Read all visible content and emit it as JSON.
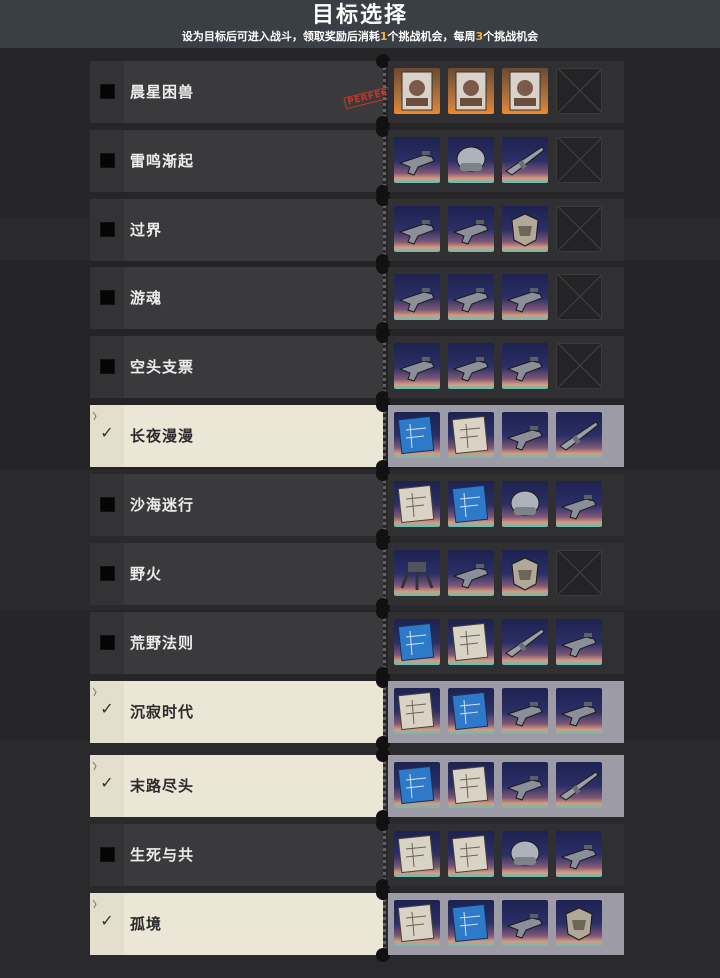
{
  "header": {
    "title": "目标选择",
    "subtitle_pre": "设为目标后可进入战斗，领取奖励后消耗",
    "subtitle_n1": "1",
    "subtitle_mid": "个挑战机会，每周",
    "subtitle_n2": "3",
    "subtitle_post": "个挑战机会"
  },
  "colors": {
    "accent": "#f0b43c",
    "selected_bg": "#ece6d7",
    "stamp": "#c0392b"
  },
  "rows": [
    {
      "label": "晨星困兽",
      "selected": false,
      "stamp": "PERFECT",
      "items": [
        "portrait-icon",
        "portrait-icon",
        "portrait-icon",
        "empty-slot"
      ]
    },
    {
      "label": "雷鸣渐起",
      "selected": false,
      "items": [
        "gun-icon",
        "helmet-icon",
        "rifle-icon",
        "empty-slot"
      ]
    },
    {
      "label": "过界",
      "selected": false,
      "items": [
        "gun-icon",
        "gun-icon",
        "armor-icon",
        "empty-slot"
      ]
    },
    {
      "label": "游魂",
      "selected": false,
      "items": [
        "gun-icon",
        "gun-icon",
        "gun-icon",
        "empty-slot"
      ]
    },
    {
      "label": "空头支票",
      "selected": false,
      "items": [
        "gun-icon",
        "gun-icon",
        "gun-icon",
        "empty-slot"
      ]
    },
    {
      "label": "长夜漫漫",
      "selected": true,
      "items": [
        "blueprint-icon",
        "schematic-icon",
        "gun-icon",
        "rifle-icon"
      ]
    },
    {
      "label": "沙海迷行",
      "selected": false,
      "items": [
        "schematic-icon",
        "blueprint-icon",
        "helmet-icon",
        "gun-icon"
      ]
    },
    {
      "label": "野火",
      "selected": false,
      "items": [
        "turret-icon",
        "gun-icon",
        "armor-icon",
        "empty-slot"
      ]
    },
    {
      "label": "荒野法则",
      "selected": false,
      "items": [
        "blueprint-icon",
        "schematic-icon",
        "rifle-icon",
        "gun-icon"
      ]
    },
    {
      "label": "沉寂时代",
      "selected": true,
      "items": [
        "schematic-icon",
        "blueprint-icon",
        "gun-icon",
        "gun-icon"
      ]
    },
    {
      "label": "末路尽头",
      "selected": true,
      "items": [
        "blueprint-icon",
        "schematic-icon",
        "gun-icon",
        "rifle-icon"
      ]
    },
    {
      "label": "生死与共",
      "selected": false,
      "items": [
        "schematic-icon",
        "schematic-icon",
        "helmet-icon",
        "gun-icon"
      ]
    },
    {
      "label": "孤境",
      "selected": true,
      "items": [
        "schematic-icon",
        "blueprint-icon",
        "gun-icon",
        "armor-icon"
      ]
    }
  ]
}
